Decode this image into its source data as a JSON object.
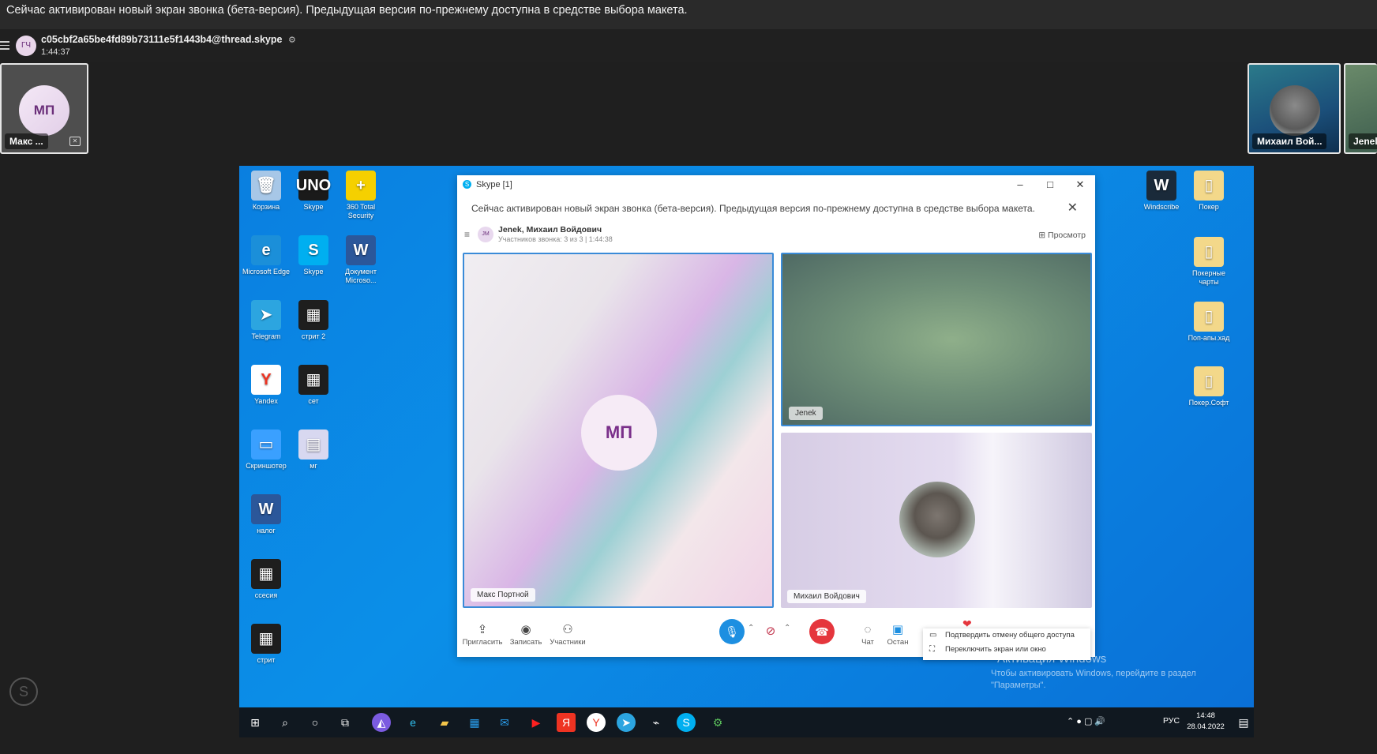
{
  "banner": {
    "text": "Сейчас активирован новый экран звонка (бета-версия). Предыдущая версия по-прежнему доступна в средстве выбора макета."
  },
  "header": {
    "avatar_initials": "ГЧ",
    "thread_id": "c05cbf2a65be4fd89b73111e5f1443b4@thread.skype",
    "duration": "1:44:37"
  },
  "thumbs": {
    "left_name": "Макс ...",
    "left_initials": "МП",
    "right1_name": "Михаил Вой...",
    "right2_name": "Jenel"
  },
  "desktop": {
    "icons_left": [
      {
        "label": "Корзина",
        "glyph": "🗑",
        "color": "#a7c7e7"
      },
      {
        "label": "Skype",
        "glyph": "UNO",
        "color": "#1a1a1a"
      },
      {
        "label": "360 Total Security",
        "glyph": "+",
        "color": "#f5d000"
      },
      {
        "label": "Microsoft Edge",
        "glyph": "e",
        "color": "#1b8fd9"
      },
      {
        "label": "Skype",
        "glyph": "S",
        "color": "#00aff0"
      },
      {
        "label": "Документ Microso...",
        "glyph": "W",
        "color": "#2b579a"
      },
      {
        "label": "Telegram",
        "glyph": "➤",
        "color": "#2ca5e0"
      },
      {
        "label": "стрит 2",
        "glyph": "▦",
        "color": "#1e1e1e"
      },
      {
        "label": "Yandex",
        "glyph": "Y",
        "color": "#ffffff"
      },
      {
        "label": "сет",
        "glyph": "▦",
        "color": "#1e1e1e"
      },
      {
        "label": "Скриншотер",
        "glyph": "▭",
        "color": "#3aa0ff"
      },
      {
        "label": "мг",
        "glyph": "▤",
        "color": "#d8d8f0"
      },
      {
        "label": "налог",
        "glyph": "W",
        "color": "#2b579a"
      },
      {
        "label": "ссесия",
        "glyph": "▦",
        "color": "#1e1e1e"
      },
      {
        "label": "стрит",
        "glyph": "▦",
        "color": "#1e1e1e"
      }
    ],
    "icons_right": [
      {
        "label": "Windscribe",
        "glyph": "W",
        "color": "#1a2a3a"
      },
      {
        "label": "Покер",
        "glyph": "▯",
        "color": "#f3d88a"
      },
      {
        "label": "Покерные чарты",
        "glyph": "▯",
        "color": "#f3d88a"
      },
      {
        "label": "Поп-апы.хад",
        "glyph": "▯",
        "color": "#f3d88a"
      },
      {
        "label": "Покер.Софт",
        "glyph": "▯",
        "color": "#f3d88a"
      }
    ],
    "watermark_title": "Активация Windows",
    "watermark_body": "Чтобы активировать Windows, перейдите в раздел \"Параметры\"."
  },
  "skype": {
    "title": "Skype [1]",
    "notice": "Сейчас активирован новый экран звонка (бета-версия). Предыдущая версия по-прежнему доступна в средстве выбора макета.",
    "call_avatar": "JM",
    "call_title": "Jenek, Михаил Войдович",
    "call_subtitle": "Участников звонка: 3 из 3 | 1:44:38",
    "view_label": "Просмотр",
    "tile_main_name": "Макс Портной",
    "tile_main_initials": "МП",
    "tile_tr_name": "Jenek",
    "tile_br_name": "Михаил Войдович",
    "controls": {
      "invite": "Пригласить",
      "record": "Записать",
      "participants": "Участники",
      "chat": "Чат",
      "stop": "Остан"
    },
    "menu": {
      "item1": "Подтвердить отмену общего доступа",
      "item2": "Переключить экран или окно"
    }
  },
  "taskbar": {
    "lang": "РУС",
    "time": "14:48",
    "date": "28.04.2022"
  }
}
